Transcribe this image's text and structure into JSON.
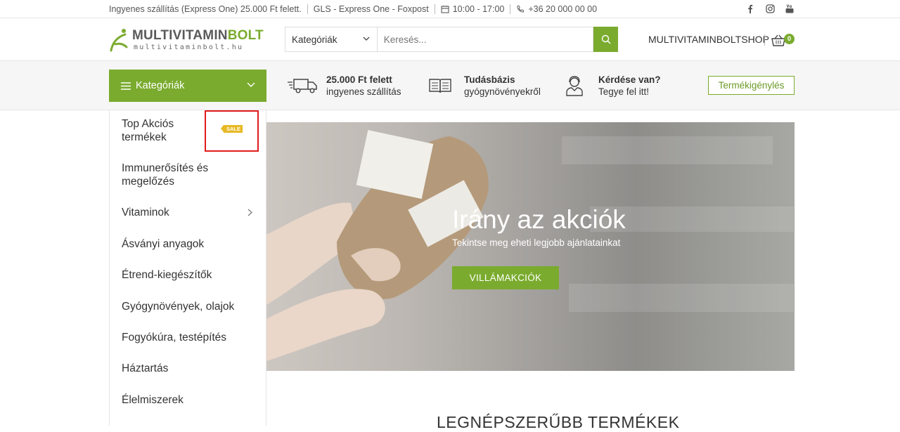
{
  "topbar": {
    "shipping": "Ingyenes szállítás (Express One) 25.000 Ft felett.",
    "carriers": "GLS - Express One - Foxpost",
    "hours": "10:00 - 17:00",
    "phone": "+36 20 000 00 00",
    "social_icons": [
      "facebook-icon",
      "instagram-icon",
      "youtube-icon"
    ]
  },
  "header": {
    "logo_main_a": "MULTIVITAMIN",
    "logo_main_b": "BOLT",
    "logo_sub": "multivitaminbolt.hu",
    "search_category": "Kategóriák",
    "search_placeholder": "Keresés...",
    "shop_name": "MULTIVITAMINBOLTSHOP",
    "cart_count": "0"
  },
  "infobar": {
    "categories_button": "Kategóriák",
    "features": [
      {
        "title": "25.000 Ft felett",
        "text": "ingyenes szállítás",
        "icon": "truck-icon"
      },
      {
        "title": "Tudásbázis",
        "text": "gyógynövényekről",
        "icon": "book-icon"
      },
      {
        "title": "Kérdése van?",
        "text": "Tegye fel itt!",
        "icon": "support-agent-icon"
      }
    ],
    "request_button": "Termékigénylés"
  },
  "menu": {
    "items": [
      {
        "label_1": "Top Akciós",
        "label_2": "termékek"
      },
      {
        "label_1": "Immunerősítés és",
        "label_2": "megelőzés"
      },
      {
        "label_1": "Vitaminok"
      },
      {
        "label_1": "Ásványi anyagok"
      },
      {
        "label_1": "Étrend-kiegészítők"
      },
      {
        "label_1": "Gyógynövények, olajok"
      },
      {
        "label_1": "Fogyókúra, testépítés"
      },
      {
        "label_1": "Háztartás"
      },
      {
        "label_1": "Élelmiszerek"
      }
    ],
    "sale_badge": "SALE"
  },
  "hero": {
    "title": "Irány az akciók",
    "subtitle": "Tekintse meg eheti legjobb ajánlatainkat",
    "cta": "VILLÁMAKCIÓK"
  },
  "section_title": "LEGNÉPSZERŰBB TERMÉKEK",
  "colors": {
    "accent": "#7aab2e",
    "highlight_box": "#e21b1b",
    "sale": "#e8b925"
  }
}
